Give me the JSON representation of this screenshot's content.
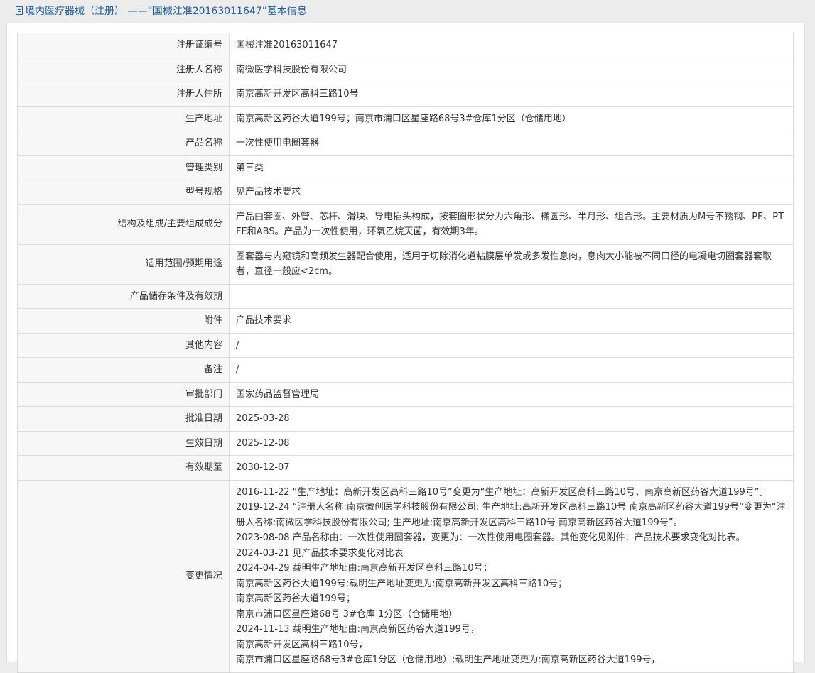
{
  "header": {
    "title": "境内医疗器械（注册） ——“国械注准20163011647”基本信息"
  },
  "rows": [
    {
      "label": "注册证编号",
      "value": "国械注准20163011647"
    },
    {
      "label": "注册人名称",
      "value": "南微医学科技股份有限公司"
    },
    {
      "label": "注册人住所",
      "value": "南京高新开发区高科三路10号"
    },
    {
      "label": "生产地址",
      "value": "南京高新区药谷大道199号；南京市浦口区星座路68号3#仓库1分区（仓储用地）"
    },
    {
      "label": "产品名称",
      "value": "一次性使用电圈套器"
    },
    {
      "label": "管理类别",
      "value": "第三类"
    },
    {
      "label": "型号规格",
      "value": "见产品技术要求"
    },
    {
      "label": "结构及组成/主要组成成分",
      "value": "产品由套圈、外管、芯杆、滑块、导电插头构成，按套圈形状分为六角形、椭圆形、半月形、组合形。主要材质为M号不锈钢、PE、PTFE和ABS。产品为一次性使用，环氧乙烷灭菌，有效期3年。"
    },
    {
      "label": "适用范围/预期用途",
      "value": "圈套器与内窥镜和高频发生器配合使用，适用于切除消化道粘膜层单发或多发性息肉，息肉大小能被不同口径的电凝电切圈套器套取者，直径一般应<2cm。"
    },
    {
      "label": "产品储存条件及有效期",
      "value": ""
    },
    {
      "label": "附件",
      "value": "产品技术要求"
    },
    {
      "label": "其他内容",
      "value": "/"
    },
    {
      "label": "备注",
      "value": "/"
    },
    {
      "label": "审批部门",
      "value": "国家药品监督管理局"
    },
    {
      "label": "批准日期",
      "value": "2025-03-28"
    },
    {
      "label": "生效日期",
      "value": "2025-12-08"
    },
    {
      "label": "有效期至",
      "value": "2030-12-07"
    }
  ],
  "changes": {
    "label": "变更情况",
    "lines": [
      "2016-11-22 “生产地址：高新开发区高科三路10号”变更为“生产地址：高新开发区高科三路10号、南京高新区药谷大道199号”。",
      "2019-12-24 “注册人名称:南京微创医学科技股份有限公司; 生产地址:高新开发区高科三路10号 南京高新区药谷大道199号”变更为“注册人名称:南微医学科技股份有限公司; 生产地址:南京高新开发区高科三路10号 南京高新区药谷大道199号”。",
      "2023-08-08 产品名称由：一次性使用圈套器，变更为：一次性使用电圈套器。其他变化见附件：产品技术要求变化对比表。",
      "2024-03-21 见产品技术要求变化对比表",
      "2024-04-29 载明生产地址由:南京高新开发区高科三路10号；",
      "南京高新区药谷大道199号;载明生产地址变更为:南京高新开发区高科三路10号；",
      "南京高新区药谷大道199号；",
      "南京市浦口区星座路68号 3#仓库 1分区（仓储用地）",
      "2024-11-13 载明生产地址由:南京高新区药谷大道199号，",
      "南京高新开发区高科三路10号，",
      "南京市浦口区星座路68号3#仓库1分区（仓储用地）;载明生产地址变更为:南京高新区药谷大道199号，"
    ]
  }
}
